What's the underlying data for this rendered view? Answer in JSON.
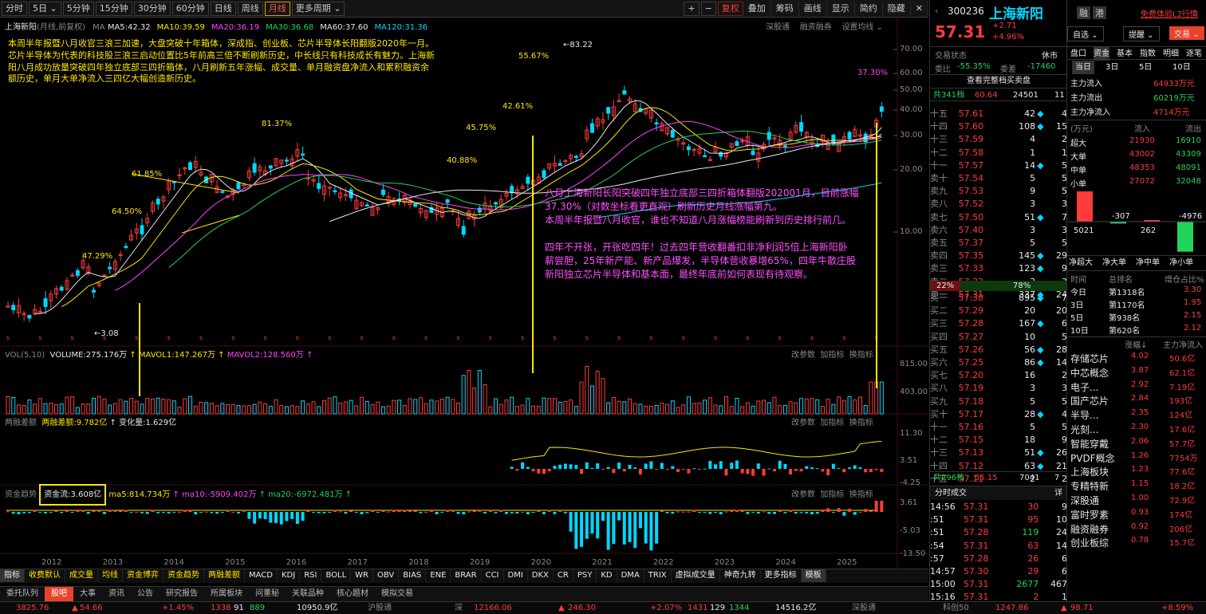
{
  "toolbar": {
    "periods": [
      "分时",
      "5日",
      "5分钟",
      "15分钟",
      "30分钟",
      "60分钟",
      "日线",
      "周线",
      "月线",
      "更多周期"
    ],
    "selected": "月线",
    "right_buttons": [
      "复权",
      "叠加",
      "筹码",
      "画线",
      "显示",
      "简约",
      "隐藏"
    ]
  },
  "chart": {
    "title": "上海新阳",
    "subtitle": "(月线,前复权)",
    "ma_label": "MA",
    "ma": [
      {
        "t": "MA5:42.32",
        "c": "#e8e8e8"
      },
      {
        "t": "MA10:39.59",
        "c": "#ffe600"
      },
      {
        "t": "MA20:36.19",
        "c": "#ff44ff"
      },
      {
        "t": "MA30:36.68",
        "c": "#22d35a"
      },
      {
        "t": "MA60:37.60",
        "c": "#e8e8e8"
      },
      {
        "t": "MA120:31.36",
        "c": "#00d7ff"
      }
    ],
    "links": [
      "深股通",
      "融资融券",
      "设置均线"
    ],
    "y_ticks": [
      "70.00",
      "60.00",
      "50.00",
      "40.00",
      "30.00",
      "20.00",
      "10.00"
    ],
    "x_ticks": [
      "2012",
      "2013",
      "2014",
      "2015",
      "2016",
      "2017",
      "2018",
      "2019",
      "2020",
      "2021",
      "2022",
      "2023",
      "2024",
      "2025"
    ],
    "pct_labels": [
      "47.29%",
      "64.50%",
      "61.85%",
      "81.37%",
      "45.75%",
      "40.88%",
      "42.61%",
      "55.67%",
      "37.30%"
    ],
    "price_marks": [
      "83.22",
      "3.08"
    ],
    "note_tl": [
      "本周半年报暨八月收官三浪三加速，大盘突破十年箱体，深成指、创业板、芯片半导体长阳翻版2020年一月。",
      "芯片半导体为代表的科技股三浪三启动位置比5年前高三倍不断刷新历史，中长线只有科技成长有魅力。上海新",
      "阳八月成功放量突破四年独立底部三四折箱体，八月刷新五年涨幅、成交量、单月融资盘净流入和累积融资余",
      "额历史，单月大单净流入三四亿大幅创造新历史。"
    ],
    "note_mid": [
      "八月上海新阳长阳突破四年独立底部三四折箱体翻版202001月，目前涨幅",
      "37.30%（对数坐标看更直观）刷新历史月线涨幅第九。",
      "本周半年报暨八月收官，谁也不知道八月涨幅榜能刷新到历史排行前几。",
      "",
      "四年不开张，开张吃四年！过去四年营收翻番扣非净利润5倍上海新阳卧",
      "薪尝胆，25年新产能、新产品爆发，半导体营收暴增65%，四年牛散庄股",
      "新阳独立芯片半导体和基本面，最终年底前如何表现有待观察。"
    ]
  },
  "vol": {
    "label": "VOL(5,10)",
    "v": "VOLUME:275.176万",
    "m1": "MAVOL1:147.267万",
    "m2": "MAVOL2:128.560万",
    "ticks": [
      "815.00",
      "403.00"
    ],
    "links": [
      "改参数",
      "加指标",
      "换指标"
    ]
  },
  "margin": {
    "label": "两融差额",
    "v": "两融差额:9.782亿",
    "chg": "变化量:1.629亿",
    "ticks": [
      "11.30",
      "3.51",
      "-4.25"
    ],
    "links": [
      "改参数",
      "加指标",
      "换指标"
    ]
  },
  "flow": {
    "label": "资金趋势",
    "v": "资金流:3.608亿",
    "ma5": "ma5:814.734万",
    "ma10": "ma10:-5909.402万",
    "ma20": "ma20:-6972.481万",
    "ticks": [
      "3.61",
      "-5.03",
      "-13.50"
    ],
    "links": [
      "改参数",
      "加指标",
      "换指标"
    ]
  },
  "ind_tabs": [
    "指标",
    "收费默认",
    "成交量",
    "均线",
    "资金博弈",
    "资金趋势",
    "两融差额",
    "MACD",
    "KDJ",
    "RSI",
    "BOLL",
    "WR",
    "OBV",
    "BIAS",
    "ENE",
    "BRAR",
    "CCI",
    "DMI",
    "DKX",
    "CR",
    "PSY",
    "KD",
    "DMA",
    "TRIX",
    "虚拟成交量",
    "神奇九转",
    "更多指标",
    "模板"
  ],
  "bottom_tabs": [
    "委托队列",
    "股吧",
    "大事",
    "资讯",
    "公告",
    "研究报告",
    "所属板块",
    "问董秘",
    "关联品种",
    "核心题材",
    "模拟交易"
  ],
  "status": {
    "sh": "3825.76",
    "sh_chg": "54.66",
    "sh_pct": "+1.45%",
    "sh_up": "1338",
    "sh_f": "91",
    "sh_dn": "889",
    "sh_amt": "10950.9亿",
    "sz_label": "深",
    "sz": "12166.06",
    "sz_chg": "246.30",
    "sz_pct": "+2.07%",
    "sz_up": "1431",
    "sz_f": "129",
    "sz_dn": "1344",
    "sz_amt": "14516.2亿",
    "hgt": "沪股通",
    "sgt": "深股通",
    "kc": "科创50",
    "kc_v": "1247.86",
    "kc_chg": "98.71",
    "kc_pct": "+8.59%"
  },
  "quote": {
    "code": "300236",
    "name": "上海新阳",
    "tags": [
      "融",
      "港"
    ],
    "trial": "免费体验L2行情",
    "price": "57.31",
    "chg": "+2.71",
    "pct": "+4.96%",
    "btns": [
      "自选",
      "提醒",
      "交易"
    ],
    "state_label": "交易状态",
    "state": "休市",
    "wb_label": "委比",
    "wb": "-55.35%",
    "wc_label": "委差",
    "wc": "-17460",
    "full_btn": "查看完整档买卖盘",
    "sell_total": [
      "共341档",
      "60.64",
      "24501",
      "11"
    ],
    "buy_total": [
      "共296档",
      "55.15",
      "7041",
      "7"
    ],
    "sells": [
      [
        "十五",
        "57.61",
        "42",
        "4"
      ],
      [
        "十四",
        "57.60",
        "108",
        "15"
      ],
      [
        "十三",
        "57.59",
        "4",
        "2"
      ],
      [
        "十二",
        "57.58",
        "1",
        "1"
      ],
      [
        "十一",
        "57.57",
        "14",
        "5"
      ],
      [
        "卖十",
        "57.54",
        "5",
        "5"
      ],
      [
        "卖九",
        "57.53",
        "9",
        "5"
      ],
      [
        "卖八",
        "57.52",
        "3",
        "3"
      ],
      [
        "卖七",
        "57.50",
        "51",
        "7"
      ],
      [
        "卖六",
        "57.40",
        "3",
        "3"
      ],
      [
        "卖五",
        "57.37",
        "5",
        "5"
      ],
      [
        "卖四",
        "57.35",
        "145",
        "29"
      ],
      [
        "卖三",
        "57.33",
        "123",
        "9"
      ],
      [
        "卖二",
        "57.32",
        "3",
        "3"
      ],
      [
        "卖一",
        "57.31",
        "337",
        "24"
      ]
    ],
    "bar_sell": "22%",
    "bar_buy": "78%",
    "buys": [
      [
        "买一",
        "57.30",
        "895",
        "7"
      ],
      [
        "买二",
        "57.29",
        "20",
        "20"
      ],
      [
        "买三",
        "57.28",
        "167",
        "6"
      ],
      [
        "买四",
        "57.27",
        "10",
        "5"
      ],
      [
        "买五",
        "57.26",
        "56",
        "28"
      ],
      [
        "买六",
        "57.25",
        "86",
        "14"
      ],
      [
        "买七",
        "57.20",
        "16",
        "2"
      ],
      [
        "买八",
        "57.19",
        "3",
        "3"
      ],
      [
        "买九",
        "57.18",
        "5",
        "5"
      ],
      [
        "买十",
        "57.17",
        "28",
        "4"
      ],
      [
        "十一",
        "57.16",
        "5",
        "5"
      ],
      [
        "十二",
        "57.15",
        "18",
        "9"
      ],
      [
        "十三",
        "57.13",
        "51",
        "26"
      ],
      [
        "十四",
        "57.12",
        "63",
        "21"
      ],
      [
        "十五",
        "57.11",
        "2",
        "2"
      ]
    ],
    "ticks_title": "分时成交",
    "ticks_more": "详",
    "ticks": [
      [
        "14:56",
        "57.31",
        "30",
        "9"
      ],
      [
        ":51",
        "57.31",
        "95",
        "10"
      ],
      [
        ":51",
        "57.28",
        "119",
        "24"
      ],
      [
        ":54",
        "57.31",
        "63",
        "14"
      ],
      [
        ":57",
        "57.28",
        "26",
        "6"
      ],
      [
        "14:57",
        "57.30",
        "29",
        "6"
      ],
      [
        "15:00",
        "57.31",
        "2677",
        "467"
      ],
      [
        "15:16",
        "57.31",
        "2",
        "1"
      ]
    ]
  },
  "fund": {
    "tabs": [
      "盘口",
      "资金",
      "基本",
      "指数",
      "明细",
      "逐笔"
    ],
    "sub": [
      "当日",
      "3日",
      "5日",
      "10日"
    ],
    "flow": [
      [
        "主力流入",
        "64933万元"
      ],
      [
        "主力流出",
        "60219万元"
      ],
      [
        "主力净流入",
        "4714万元"
      ]
    ],
    "unit": "(万元)",
    "in": "流入",
    "out": "流出",
    "rows": [
      [
        "超大",
        "21930",
        "16910"
      ],
      [
        "大单",
        "43002",
        "43309"
      ],
      [
        "中单",
        "48353",
        "48091"
      ],
      [
        "小单",
        "27072",
        "32048"
      ]
    ],
    "bars": [
      "5021",
      "-307",
      "262",
      "-4976"
    ],
    "bar_labels": [
      "净超大",
      "净大单",
      "净中单",
      "净小单"
    ],
    "rank_head": [
      "时间",
      "总排名",
      "增仓占比%"
    ],
    "rank": [
      [
        "今日",
        "第1318名",
        "3.30"
      ],
      [
        "3日",
        "第1170名",
        "1.95"
      ],
      [
        "5日",
        "第938名",
        "2.15"
      ],
      [
        "10日",
        "第620名",
        "2.12"
      ]
    ],
    "sec_head": [
      "涨幅↓",
      "主力净流入"
    ],
    "sectors": [
      [
        "存储芯片",
        "4.02",
        "50.6亿"
      ],
      [
        "中芯概念",
        "3.87",
        "62.1亿"
      ],
      [
        "电子...",
        "2.92",
        "7.19亿"
      ],
      [
        "国产芯片",
        "2.84",
        "193亿"
      ],
      [
        "半导...",
        "2.35",
        "124亿"
      ],
      [
        "光刻...",
        "2.30",
        "17.6亿"
      ],
      [
        "智能穿戴",
        "2.06",
        "57.7亿"
      ],
      [
        "PVDF概念",
        "1.26",
        "7754万"
      ],
      [
        "上海板块",
        "1.23",
        "77.6亿"
      ],
      [
        "专精特新",
        "1.15",
        "18.2亿"
      ],
      [
        "深股通",
        "1.00",
        "72.9亿"
      ],
      [
        "富时罗素",
        "0.93",
        "174亿"
      ],
      [
        "融资融券",
        "0.92",
        "206亿"
      ],
      [
        "创业板综",
        "0.78",
        "15.7亿"
      ]
    ]
  }
}
